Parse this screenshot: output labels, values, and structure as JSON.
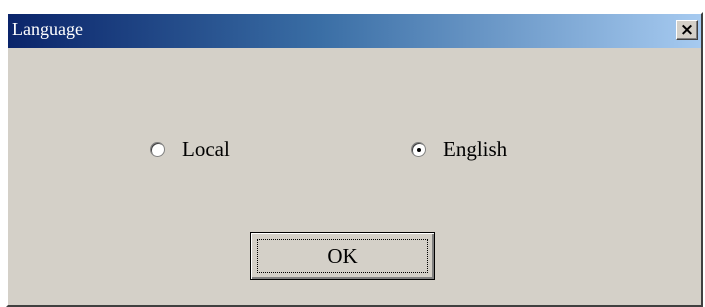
{
  "window": {
    "title": "Language",
    "close_glyph": "×"
  },
  "options": {
    "local_label": "Local",
    "english_label": "English",
    "selected": "English"
  },
  "buttons": {
    "ok_label": "OK"
  },
  "colors": {
    "dialog_bg": "#d4d0c8",
    "title_gradient_start": "#0a246a",
    "title_gradient_end": "#a6caf0"
  },
  "icons": {
    "close": "close-icon",
    "radio_unchecked": "radio-unchecked-icon",
    "radio_checked": "radio-checked-icon"
  }
}
